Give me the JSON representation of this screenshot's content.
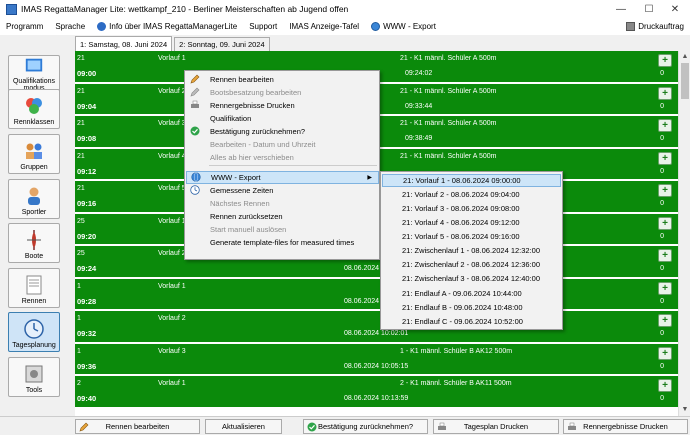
{
  "window": {
    "title": "IMAS RegattaManager Lite: wettkampf_210 - Berliner Meisterschaften ab Jugend offen"
  },
  "menu": {
    "items": [
      "Programm",
      "Sprache",
      "Info über IMAS RegattaManagerLite",
      "Support",
      "IMAS Anzeige-Tafel",
      "WWW - Export"
    ],
    "print_order": "Druckauftrag"
  },
  "sidebar": {
    "items": [
      {
        "label": "Qualifikations modus",
        "icon": "qualification-icon"
      },
      {
        "label": "Rennklassen",
        "icon": "race-classes-icon"
      },
      {
        "label": "Gruppen",
        "icon": "groups-icon"
      },
      {
        "label": "Sportler",
        "icon": "athletes-icon"
      },
      {
        "label": "Boote",
        "icon": "boats-icon"
      },
      {
        "label": "Rennen",
        "icon": "races-icon"
      },
      {
        "label": "Tagesplanung",
        "icon": "day-planning-icon"
      },
      {
        "label": "Tools",
        "icon": "tools-icon"
      }
    ],
    "active": "Tagesplanung"
  },
  "tabs": [
    "1: Samstag, 08. Juni 2024",
    "2: Sonntag, 09. Juni 2024"
  ],
  "rows": [
    {
      "num": "21",
      "time": "09:00",
      "lauf": "Vorlauf 1",
      "date": "",
      "race": "21 - K1 männl. Schüler A   500m",
      "zero": "0",
      "time2": "09:24:02"
    },
    {
      "num": "21",
      "time": "09:04",
      "lauf": "Vorlauf 2",
      "date": "",
      "race": "21 - K1 männl. Schüler A   500m",
      "zero": "0",
      "time2": "09:33:44"
    },
    {
      "num": "21",
      "time": "09:08",
      "lauf": "Vorlauf 3",
      "date": "",
      "race": "21 - K1 männl. Schüler A   500m",
      "zero": "0",
      "time2": "09:38:49"
    },
    {
      "num": "21",
      "time": "09:12",
      "lauf": "Vorlauf 4",
      "date": "",
      "race": "21 - K1 männl. Schüler A   500m",
      "zero": "0",
      "time2": ""
    },
    {
      "num": "21",
      "time": "09:16",
      "lauf": "Vorlauf 5",
      "date": "",
      "race": "21 - K1 männl. Schüler A   500m",
      "zero": "0",
      "time2": ""
    },
    {
      "num": "25",
      "time": "09:20",
      "lauf": "Vorlauf 1",
      "date": "",
      "race": "25 - K1 weibl. Schüler A   500m",
      "zero": "0",
      "time2": ""
    },
    {
      "num": "25",
      "time": "09:24",
      "lauf": "Vorlauf 2",
      "date": "08.06.2024",
      "race": "25 - K1 weibl. Schüler A   500m",
      "zero": "0",
      "time2": ""
    },
    {
      "num": "1",
      "time": "09:28",
      "lauf": "Vorlauf 1",
      "date": "08.06.2024",
      "race": "1 - K1 männl. Schüler B   500m",
      "zero": "0",
      "time2": ""
    },
    {
      "num": "1",
      "time": "09:32",
      "lauf": "Vorlauf 2",
      "date": "08.06.2024 10:02:01",
      "race": "1 - K1 männl. Schüler B   500m",
      "zero": "0",
      "time2": ""
    },
    {
      "num": "1",
      "time": "09:36",
      "lauf": "Vorlauf 3",
      "date": "08.06.2024 10:05:15",
      "race": "1 - K1 männl. Schüler B AK12   500m",
      "zero": "0",
      "time2": ""
    },
    {
      "num": "2",
      "time": "09:40",
      "lauf": "Vorlauf 1",
      "date": "08.06.2024 10:13:59",
      "race": "2 - K1 männl. Schüler B AK11   500m",
      "zero": "0",
      "time2": ""
    }
  ],
  "context_menu": {
    "items": [
      {
        "label": "Rennen bearbeiten",
        "icon": "pencil-icon",
        "disabled": false
      },
      {
        "label": "Bootsbesatzung bearbeiten",
        "icon": "pencil-gray-icon",
        "disabled": true
      },
      {
        "label": "Rennergebnisse Drucken",
        "icon": "printer-icon",
        "disabled": false
      },
      {
        "label": "Qualifikation",
        "icon": "",
        "disabled": false
      },
      {
        "label": "Bestätigung zurücknehmen?",
        "icon": "check-green-icon",
        "disabled": false
      },
      {
        "label": "Bearbeiten - Datum und Uhrzeit",
        "icon": "",
        "disabled": true
      },
      {
        "label": "Alles ab hier verschieben",
        "icon": "",
        "disabled": true
      },
      {
        "label": "WWW - Export",
        "icon": "globe-icon",
        "disabled": false,
        "submenu": true
      },
      {
        "label": "Gemessene Zeiten",
        "icon": "clock-icon",
        "disabled": false
      },
      {
        "label": "Nächstes Rennen",
        "icon": "",
        "disabled": true
      },
      {
        "label": "Rennen zurücksetzen",
        "icon": "",
        "disabled": false
      },
      {
        "label": "Start manuell auslösen",
        "icon": "",
        "disabled": true
      },
      {
        "label": "Generate template-files for measured times",
        "icon": "",
        "disabled": false
      }
    ]
  },
  "submenu": {
    "items": [
      "21: Vorlauf 1 - 08.06.2024 09:00:00",
      "21: Vorlauf 2 - 08.06.2024 09:04:00",
      "21: Vorlauf 3 - 08.06.2024 09:08:00",
      "21: Vorlauf 4 - 08.06.2024 09:12:00",
      "21: Vorlauf 5 - 08.06.2024 09:16:00",
      "21: Zwischenlauf 1 - 08.06.2024 12:32:00",
      "21: Zwischenlauf 2 - 08.06.2024 12:36:00",
      "21: Zwischenlauf 3 - 08.06.2024 12:40:00",
      "21: Endlauf A - 09.06.2024 10:44:00",
      "21: Endlauf B - 09.06.2024 10:48:00",
      "21: Endlauf C - 09.06.2024 10:52:00"
    ]
  },
  "bottom": {
    "edit_race": "Rennen bearbeiten",
    "refresh": "Aktualisieren",
    "confirm_back": "Bestätigung zurücknehmen?",
    "print_plan": "Tagesplan Drucken",
    "print_results": "Rennergebnisse Drucken"
  },
  "colors": {
    "row_green": "#0b8a0b",
    "highlight": "#cde5f8"
  }
}
